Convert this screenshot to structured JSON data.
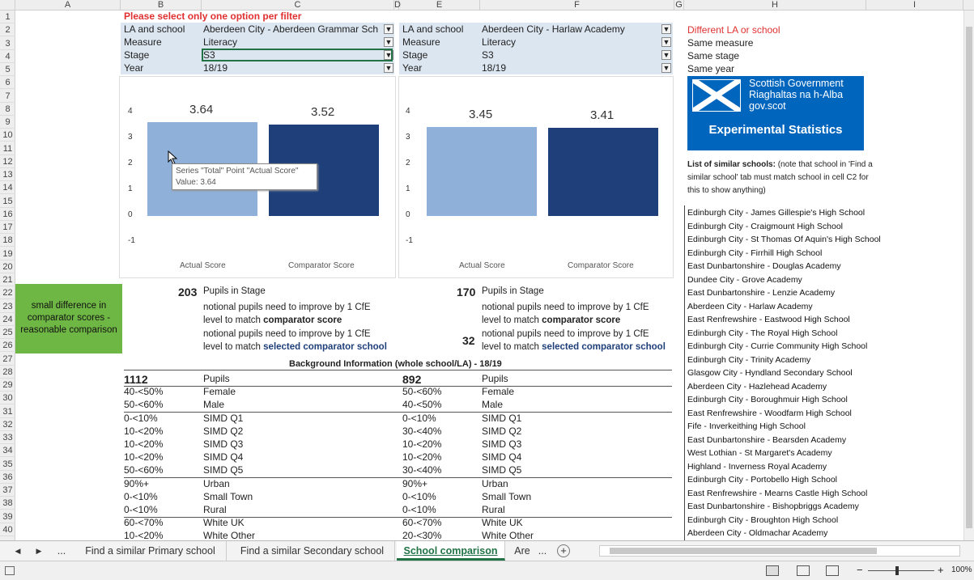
{
  "columns": [
    "A",
    "B",
    "C",
    "D",
    "E",
    "F",
    "G",
    "H",
    "I"
  ],
  "rows": [
    "1",
    "2",
    "3",
    "4",
    "5",
    "6",
    "7",
    "8",
    "9",
    "10",
    "11",
    "12",
    "13",
    "14",
    "15",
    "16",
    "17",
    "18",
    "19",
    "20",
    "21",
    "22",
    "23",
    "24",
    "25",
    "26",
    "27",
    "28",
    "29",
    "30",
    "31",
    "32",
    "33",
    "34",
    "35",
    "36",
    "37",
    "38",
    "39",
    "40"
  ],
  "warning": "Please select only one option per filter",
  "left_filters": [
    {
      "label": "LA and school",
      "value": "Aberdeen City - Aberdeen Grammar Sch"
    },
    {
      "label": "Measure",
      "value": "Literacy"
    },
    {
      "label": "Stage",
      "value": "S3"
    },
    {
      "label": "Year",
      "value": "18/19"
    }
  ],
  "right_filters": [
    {
      "label": "LA and school",
      "value": "Aberdeen City - Harlaw Academy"
    },
    {
      "label": "Measure",
      "value": "Literacy"
    },
    {
      "label": "Stage",
      "value": "S3"
    },
    {
      "label": "Year",
      "value": "18/19"
    }
  ],
  "filter_icon": "filter-icon",
  "side_notes": {
    "different": "Different LA or school",
    "measure": "Same measure",
    "stage": "Same stage",
    "year": "Same year"
  },
  "logo": {
    "line1": "Scottish Government",
    "line2": "Riaghaltas na h-Alba",
    "line3": "gov.scot",
    "banner": "Experimental Statistics"
  },
  "similar_title": "List of similar schools:",
  "similar_note": " (note that school in 'Find a similar school' tab must match school in cell C2 for this to show anything)",
  "similar_schools": [
    "Edinburgh City - James Gillespie's High School",
    "Edinburgh City - Craigmount High School",
    "Edinburgh City - St Thomas Of Aquin's High School",
    "Edinburgh City - Firrhill High School",
    "East Dunbartonshire - Douglas Academy",
    "Dundee City - Grove Academy",
    "East Dunbartonshire - Lenzie Academy",
    "Aberdeen City - Harlaw Academy",
    "East Renfrewshire - Eastwood High School",
    "Edinburgh City - The Royal High School",
    "Edinburgh City - Currie Community High School",
    "Edinburgh City - Trinity Academy",
    "Glasgow City - Hyndland Secondary School",
    "Aberdeen City - Hazlehead Academy",
    "Edinburgh City - Boroughmuir High School",
    "East Renfrewshire - Woodfarm High School",
    "Fife - Inverkeithing High School",
    "East Dunbartonshire - Bearsden Academy",
    "West Lothian - St Margaret's Academy",
    "Highland - Inverness Royal Academy",
    "Edinburgh City - Portobello High School",
    "East Renfrewshire - Mearns Castle High School",
    "East Dunbartonshire - Bishopbriggs Academy",
    "Edinburgh City - Broughton High School",
    "Aberdeen City - Oldmachar Academy"
  ],
  "chart_data": [
    {
      "type": "bar",
      "categories": [
        "Actual Score",
        "Comparator Score"
      ],
      "values": [
        3.64,
        3.52
      ],
      "ylim": [
        -1,
        4
      ],
      "colors": [
        "#8eb0d9",
        "#1f3f7a"
      ],
      "tooltip": {
        "line1": "Series \"Total\" Point \"Actual Score\"",
        "line2": "Value: 3.64"
      }
    },
    {
      "type": "bar",
      "categories": [
        "Actual Score",
        "Comparator Score"
      ],
      "values": [
        3.45,
        3.41
      ],
      "ylim": [
        -1,
        4
      ],
      "colors": [
        "#8eb0d9",
        "#1f3f7a"
      ]
    }
  ],
  "y_ticks": [
    "4",
    "3",
    "2",
    "1",
    "0",
    "-1"
  ],
  "green_note": "small difference in comparator scores - reasonable comparison",
  "left_pupils": {
    "count": "203",
    "label": "Pupils in Stage",
    "l1": "notional pupils need to improve by 1 CfE",
    "l2a": "level to match ",
    "l2b": "comparator score",
    "l3": "notional pupils need to improve by 1 CfE",
    "l4a": "level to match ",
    "l4b": "selected comparator school"
  },
  "right_pupils": {
    "count": "170",
    "label": "Pupils in Stage",
    "l1": "notional pupils need to improve by 1 CfE",
    "l2a": "level to match ",
    "l2b": "comparator score",
    "n3": "32",
    "l3": "notional pupils need to improve by 1 CfE",
    "l4a": "level to match ",
    "l4b": "selected comparator school"
  },
  "background_title": "Background Information (whole school/LA) - 18/19",
  "bg_labels": [
    "Pupils",
    "Female",
    "Male",
    "SIMD Q1",
    "SIMD Q2",
    "SIMD Q3",
    "SIMD Q4",
    "SIMD Q5",
    "Urban",
    "Small Town",
    "Rural",
    "White UK",
    "White Other"
  ],
  "bg_left": [
    "1112",
    "40-<50%",
    "50-<60%",
    "0-<10%",
    "10-<20%",
    "10-<20%",
    "10-<20%",
    "50-<60%",
    "90%+",
    "0-<10%",
    "0-<10%",
    "60-<70%",
    "10-<20%"
  ],
  "bg_right": [
    "892",
    "50-<60%",
    "40-<50%",
    "0-<10%",
    "30-<40%",
    "10-<20%",
    "10-<20%",
    "30-<40%",
    "90%+",
    "0-<10%",
    "0-<10%",
    "60-<70%",
    "20-<30%"
  ],
  "tabs": {
    "prev": "◀",
    "next": "▶",
    "more": "...",
    "t1": "Find a similar Primary school",
    "t2": "Find a similar Secondary school",
    "t3": "School comparison",
    "t4": "Are",
    "t4more": "...",
    "add": "+"
  },
  "zoom": "100%"
}
